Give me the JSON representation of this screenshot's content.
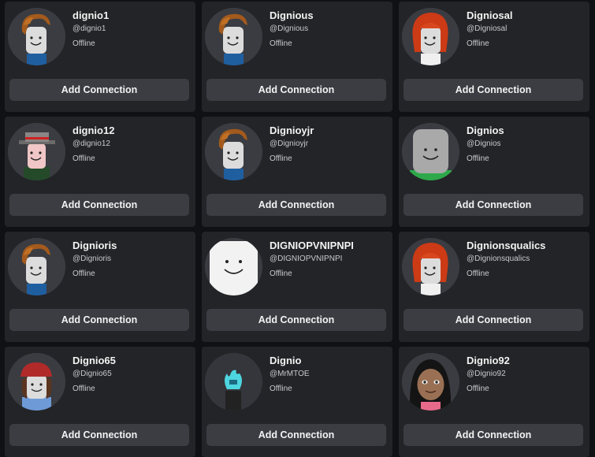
{
  "button_label": "Add Connection",
  "status_label": "Offline",
  "users": [
    {
      "name": "dignio1",
      "handle": "@dignio1",
      "avatar": "bacon-hair-avatar-icon"
    },
    {
      "name": "Dignious",
      "handle": "@Dignious",
      "avatar": "bacon-hair-avatar-icon"
    },
    {
      "name": "Digniosal",
      "handle": "@Digniosal",
      "avatar": "red-hair-avatar-icon"
    },
    {
      "name": "dignio12",
      "handle": "@dignio12",
      "avatar": "hat-avatar-icon"
    },
    {
      "name": "Dignioyjr",
      "handle": "@Dignioyjr",
      "avatar": "bacon-hair-avatar-icon"
    },
    {
      "name": "Dignios",
      "handle": "@Dignios",
      "avatar": "gray-head-avatar-icon"
    },
    {
      "name": "Dignioris",
      "handle": "@Dignioris",
      "avatar": "bacon-hair-avatar-icon"
    },
    {
      "name": "DIGNIOPVNIPNPI",
      "handle": "@DIGNIOPVNIPNPI",
      "avatar": "white-head-avatar-icon"
    },
    {
      "name": "Dignionsqualics",
      "handle": "@Dignionsqualics",
      "avatar": "red-hair-avatar-icon"
    },
    {
      "name": "Dignio65",
      "handle": "@Dignio65",
      "avatar": "cap-avatar-icon"
    },
    {
      "name": "Dignio",
      "handle": "@MrMTOE",
      "avatar": "flame-head-avatar-icon"
    },
    {
      "name": "Dignio92",
      "handle": "@Dignio92",
      "avatar": "black-hair-avatar-icon"
    }
  ],
  "colors": {
    "page_background": "#101115",
    "card_background": "#232427",
    "button_background": "#3b3d43",
    "text_primary": "#f2f2f2",
    "text_secondary": "#c8c9cc"
  }
}
